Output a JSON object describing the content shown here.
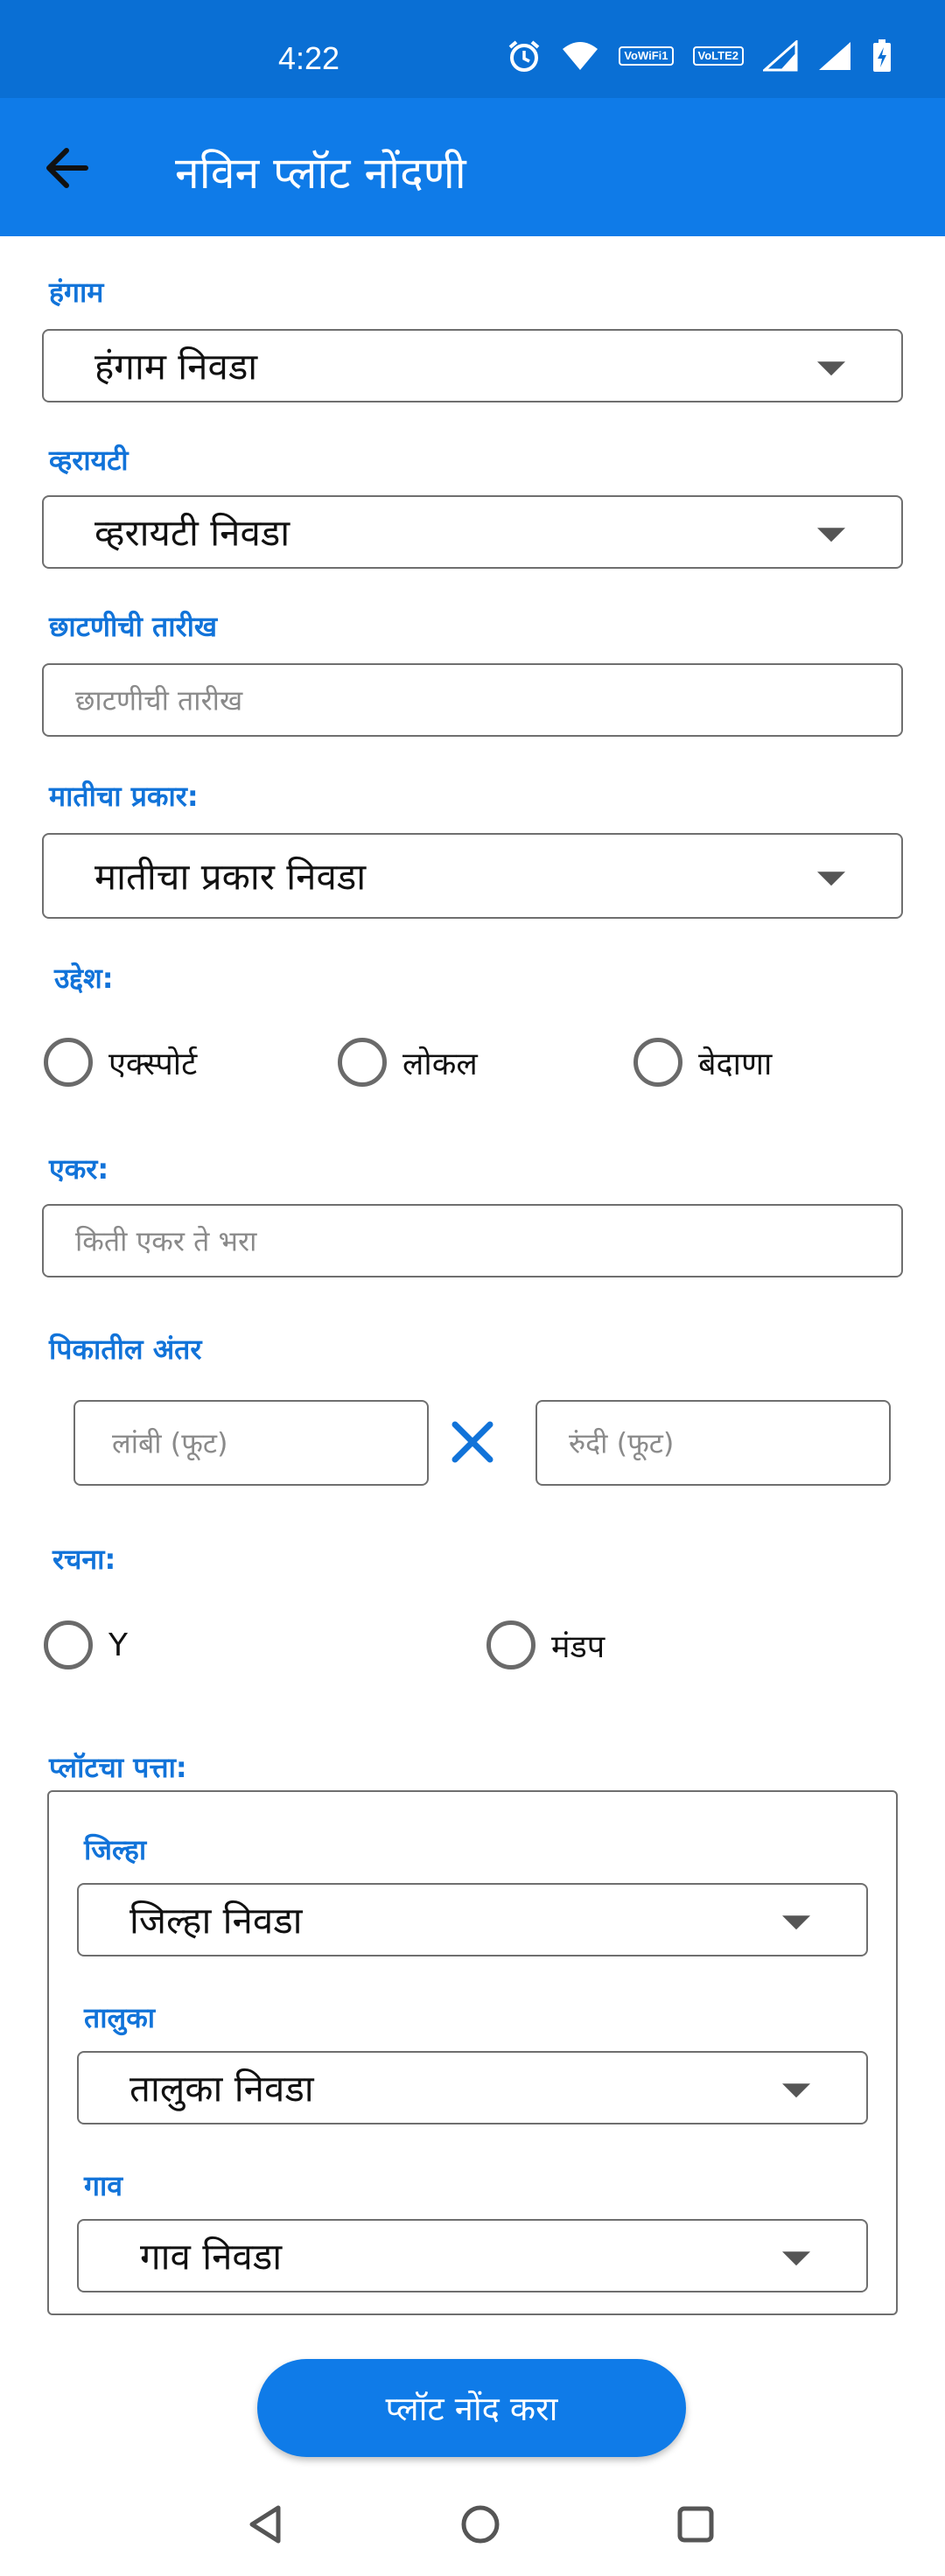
{
  "status_bar": {
    "time": "4:22",
    "wifi_badge": "VoWiFi1",
    "lte_badge": "VoLTE2"
  },
  "app_bar": {
    "title": "नविन प्लॉट नोंदणी",
    "back_icon": "arrow-back-icon"
  },
  "season": {
    "label": "हंगाम",
    "value": "हंगाम निवडा"
  },
  "variety": {
    "label": "व्हरायटी",
    "value": "व्हरायटी निवडा"
  },
  "pruning_date": {
    "label": "छाटणीची तारीख",
    "placeholder": "छाटणीची तारीख"
  },
  "soil_type": {
    "label": "मातीचा प्रकार:",
    "value": "मातीचा प्रकार निवडा"
  },
  "purpose": {
    "label": "उद्देश:",
    "options": [
      "एक्स्पोर्ट",
      "लोकल",
      "बेदाणा"
    ]
  },
  "acre": {
    "label": "एकर:",
    "placeholder": "किती एकर ते भरा"
  },
  "spacing": {
    "label": "पिकातील अंतर",
    "length_placeholder": "लांबी (फूट)",
    "width_placeholder": "रुंदी (फूट)"
  },
  "structure": {
    "label": "रचना:",
    "options": [
      "Y",
      "मंडप"
    ]
  },
  "address": {
    "label": "प्लॉटचा पत्ता:",
    "district": {
      "label": "जिल्हा",
      "value": "जिल्हा निवडा"
    },
    "taluka": {
      "label": "तालुका",
      "value": "तालुका निवडा"
    },
    "village": {
      "label": "गाव",
      "value": "गाव निवडा"
    }
  },
  "submit": {
    "label": "प्लॉट नोंद करा"
  },
  "colors": {
    "primary": "#0f7be8",
    "status_bar": "#0a6fd4",
    "label": "#1173d9"
  }
}
